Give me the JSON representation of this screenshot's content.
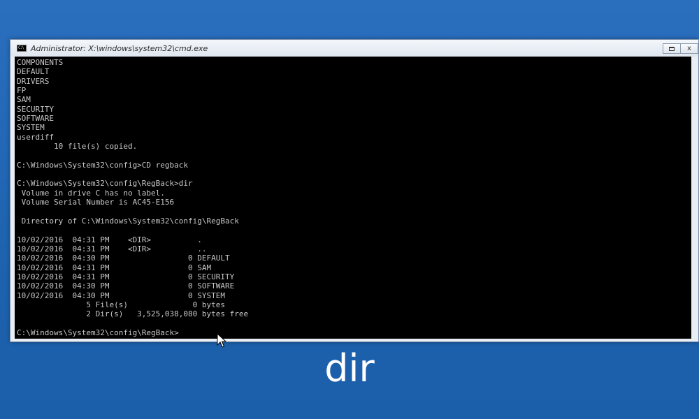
{
  "window": {
    "title": "Administrator: X:\\windows\\system32\\cmd.exe",
    "icon": "cmd-icon",
    "controls": {
      "restore_icon": "restore-icon",
      "close_label": "x"
    }
  },
  "console": {
    "lines": [
      "COMPONENTS",
      "DEFAULT",
      "DRIVERS",
      "FP",
      "SAM",
      "SECURITY",
      "SOFTWARE",
      "SYSTEM",
      "userdiff",
      "        10 file(s) copied.",
      "",
      "C:\\Windows\\System32\\config>CD regback",
      "",
      "C:\\Windows\\System32\\config\\RegBack>dir",
      " Volume in drive C has no label.",
      " Volume Serial Number is AC45-E156",
      "",
      " Directory of C:\\Windows\\System32\\config\\RegBack",
      "",
      "10/02/2016  04:31 PM    <DIR>          .",
      "10/02/2016  04:31 PM    <DIR>          ..",
      "10/02/2016  04:30 PM                 0 DEFAULT",
      "10/02/2016  04:31 PM                 0 SAM",
      "10/02/2016  04:31 PM                 0 SECURITY",
      "10/02/2016  04:30 PM                 0 SOFTWARE",
      "10/02/2016  04:30 PM                 0 SYSTEM",
      "               5 File(s)              0 bytes",
      "               2 Dir(s)   3,525,038,080 bytes free",
      "",
      "C:\\Windows\\System32\\config\\RegBack>"
    ]
  },
  "caption": "dir",
  "colors": {
    "desktop": "#1f66b5",
    "console_bg": "#000000",
    "console_text": "#c8c8c8"
  }
}
